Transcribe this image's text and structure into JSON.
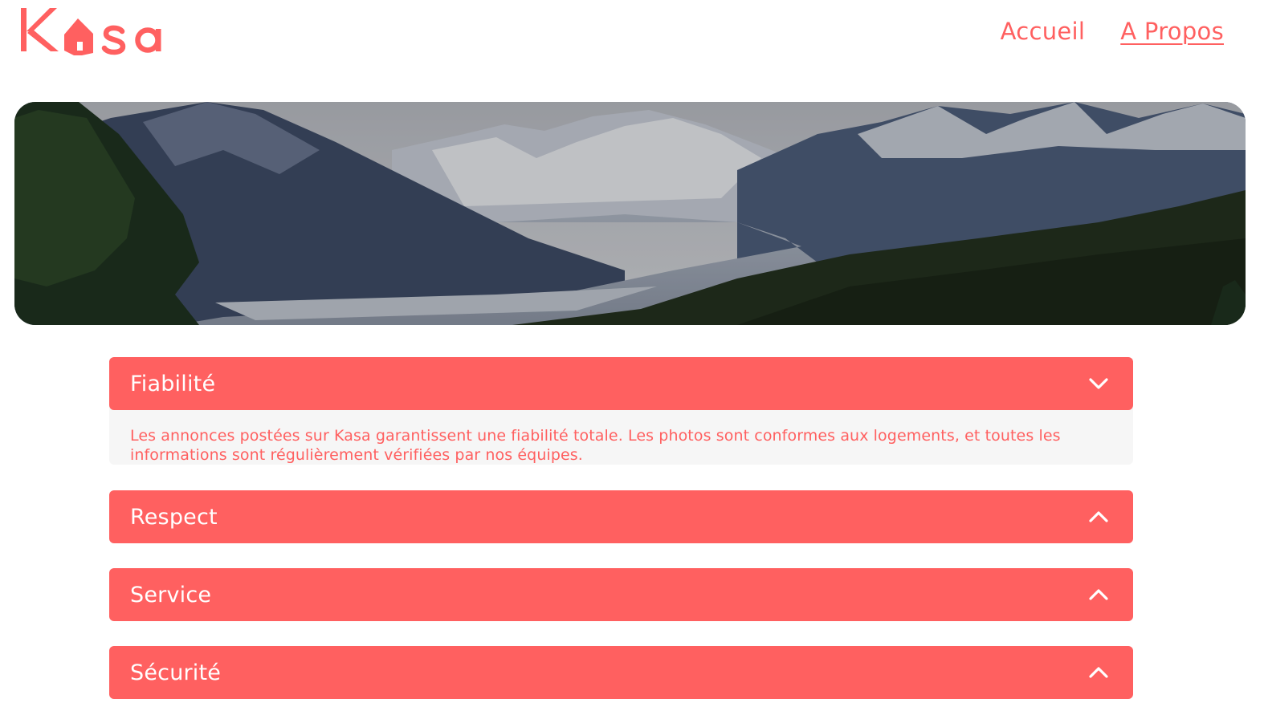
{
  "brand": {
    "name": "Kasa",
    "color": "#FF6060"
  },
  "nav": {
    "items": [
      {
        "label": "Accueil",
        "active": false
      },
      {
        "label": "A Propos",
        "active": true
      }
    ]
  },
  "banner": {
    "image": "mountain-valley-landscape"
  },
  "collapses": [
    {
      "title": "Fiabilité",
      "open": true,
      "icon": "chevron-down-icon",
      "content": "Les annonces postées sur Kasa garantissent une fiabilité totale. Les photos sont conformes aux logements, et toutes les informations sont régulièrement vérifiées par nos équipes."
    },
    {
      "title": "Respect",
      "open": false,
      "icon": "chevron-up-icon"
    },
    {
      "title": "Service",
      "open": false,
      "icon": "chevron-up-icon"
    },
    {
      "title": "Sécurité",
      "open": false,
      "icon": "chevron-up-icon"
    }
  ]
}
